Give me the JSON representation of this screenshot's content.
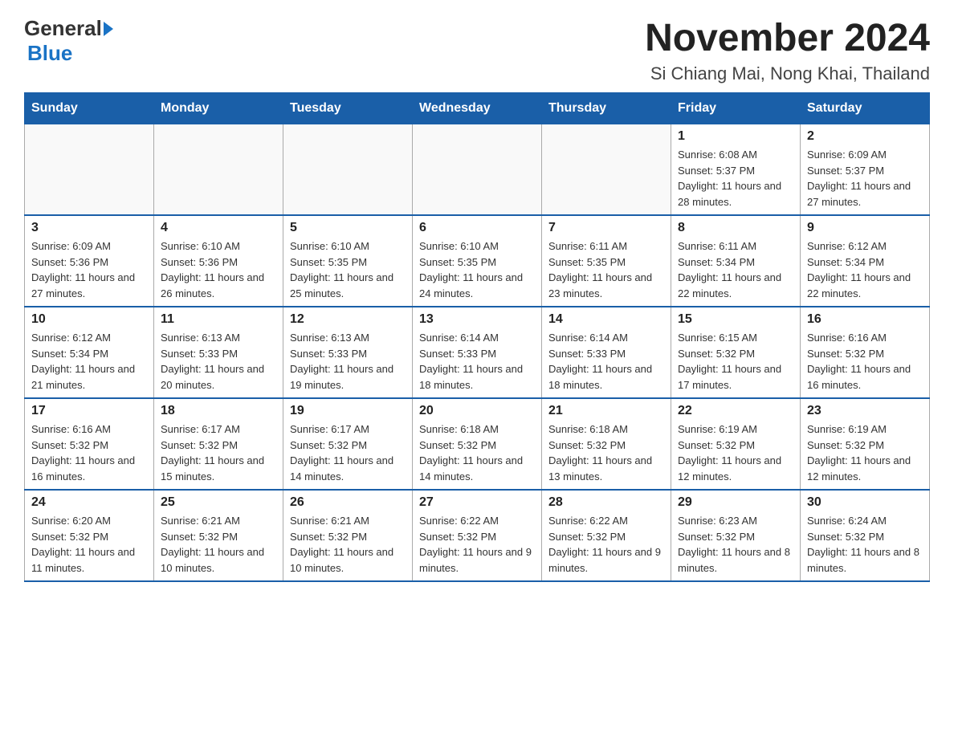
{
  "header": {
    "logo_general": "General",
    "logo_blue": "Blue",
    "main_title": "November 2024",
    "subtitle": "Si Chiang Mai, Nong Khai, Thailand"
  },
  "calendar": {
    "days_of_week": [
      "Sunday",
      "Monday",
      "Tuesday",
      "Wednesday",
      "Thursday",
      "Friday",
      "Saturday"
    ],
    "weeks": [
      [
        {
          "day": "",
          "info": ""
        },
        {
          "day": "",
          "info": ""
        },
        {
          "day": "",
          "info": ""
        },
        {
          "day": "",
          "info": ""
        },
        {
          "day": "",
          "info": ""
        },
        {
          "day": "1",
          "info": "Sunrise: 6:08 AM\nSunset: 5:37 PM\nDaylight: 11 hours and 28 minutes."
        },
        {
          "day": "2",
          "info": "Sunrise: 6:09 AM\nSunset: 5:37 PM\nDaylight: 11 hours and 27 minutes."
        }
      ],
      [
        {
          "day": "3",
          "info": "Sunrise: 6:09 AM\nSunset: 5:36 PM\nDaylight: 11 hours and 27 minutes."
        },
        {
          "day": "4",
          "info": "Sunrise: 6:10 AM\nSunset: 5:36 PM\nDaylight: 11 hours and 26 minutes."
        },
        {
          "day": "5",
          "info": "Sunrise: 6:10 AM\nSunset: 5:35 PM\nDaylight: 11 hours and 25 minutes."
        },
        {
          "day": "6",
          "info": "Sunrise: 6:10 AM\nSunset: 5:35 PM\nDaylight: 11 hours and 24 minutes."
        },
        {
          "day": "7",
          "info": "Sunrise: 6:11 AM\nSunset: 5:35 PM\nDaylight: 11 hours and 23 minutes."
        },
        {
          "day": "8",
          "info": "Sunrise: 6:11 AM\nSunset: 5:34 PM\nDaylight: 11 hours and 22 minutes."
        },
        {
          "day": "9",
          "info": "Sunrise: 6:12 AM\nSunset: 5:34 PM\nDaylight: 11 hours and 22 minutes."
        }
      ],
      [
        {
          "day": "10",
          "info": "Sunrise: 6:12 AM\nSunset: 5:34 PM\nDaylight: 11 hours and 21 minutes."
        },
        {
          "day": "11",
          "info": "Sunrise: 6:13 AM\nSunset: 5:33 PM\nDaylight: 11 hours and 20 minutes."
        },
        {
          "day": "12",
          "info": "Sunrise: 6:13 AM\nSunset: 5:33 PM\nDaylight: 11 hours and 19 minutes."
        },
        {
          "day": "13",
          "info": "Sunrise: 6:14 AM\nSunset: 5:33 PM\nDaylight: 11 hours and 18 minutes."
        },
        {
          "day": "14",
          "info": "Sunrise: 6:14 AM\nSunset: 5:33 PM\nDaylight: 11 hours and 18 minutes."
        },
        {
          "day": "15",
          "info": "Sunrise: 6:15 AM\nSunset: 5:32 PM\nDaylight: 11 hours and 17 minutes."
        },
        {
          "day": "16",
          "info": "Sunrise: 6:16 AM\nSunset: 5:32 PM\nDaylight: 11 hours and 16 minutes."
        }
      ],
      [
        {
          "day": "17",
          "info": "Sunrise: 6:16 AM\nSunset: 5:32 PM\nDaylight: 11 hours and 16 minutes."
        },
        {
          "day": "18",
          "info": "Sunrise: 6:17 AM\nSunset: 5:32 PM\nDaylight: 11 hours and 15 minutes."
        },
        {
          "day": "19",
          "info": "Sunrise: 6:17 AM\nSunset: 5:32 PM\nDaylight: 11 hours and 14 minutes."
        },
        {
          "day": "20",
          "info": "Sunrise: 6:18 AM\nSunset: 5:32 PM\nDaylight: 11 hours and 14 minutes."
        },
        {
          "day": "21",
          "info": "Sunrise: 6:18 AM\nSunset: 5:32 PM\nDaylight: 11 hours and 13 minutes."
        },
        {
          "day": "22",
          "info": "Sunrise: 6:19 AM\nSunset: 5:32 PM\nDaylight: 11 hours and 12 minutes."
        },
        {
          "day": "23",
          "info": "Sunrise: 6:19 AM\nSunset: 5:32 PM\nDaylight: 11 hours and 12 minutes."
        }
      ],
      [
        {
          "day": "24",
          "info": "Sunrise: 6:20 AM\nSunset: 5:32 PM\nDaylight: 11 hours and 11 minutes."
        },
        {
          "day": "25",
          "info": "Sunrise: 6:21 AM\nSunset: 5:32 PM\nDaylight: 11 hours and 10 minutes."
        },
        {
          "day": "26",
          "info": "Sunrise: 6:21 AM\nSunset: 5:32 PM\nDaylight: 11 hours and 10 minutes."
        },
        {
          "day": "27",
          "info": "Sunrise: 6:22 AM\nSunset: 5:32 PM\nDaylight: 11 hours and 9 minutes."
        },
        {
          "day": "28",
          "info": "Sunrise: 6:22 AM\nSunset: 5:32 PM\nDaylight: 11 hours and 9 minutes."
        },
        {
          "day": "29",
          "info": "Sunrise: 6:23 AM\nSunset: 5:32 PM\nDaylight: 11 hours and 8 minutes."
        },
        {
          "day": "30",
          "info": "Sunrise: 6:24 AM\nSunset: 5:32 PM\nDaylight: 11 hours and 8 minutes."
        }
      ]
    ]
  }
}
